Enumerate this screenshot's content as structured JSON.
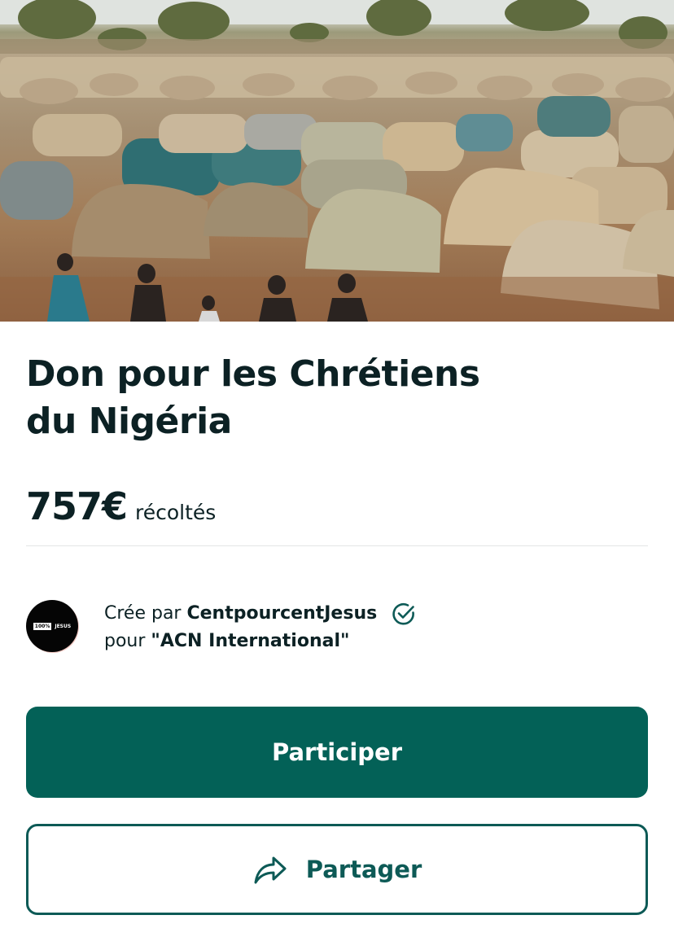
{
  "campaign": {
    "title": "Don pour les Chrétiens du Nigéria",
    "amount": "757€",
    "amount_suffix": "récoltés",
    "image_alt": "Camp de tentes"
  },
  "creator": {
    "created_by_prefix": "Crée par",
    "name": "CentpourcentJesus",
    "verified_icon": "check-circle-icon",
    "for_prefix": "pour",
    "beneficiary": "\"ACN International\"",
    "avatar_text": [
      "100%",
      "JESUS"
    ]
  },
  "actions": {
    "participate_label": "Participer",
    "share_label": "Partager",
    "share_icon": "share-arrow-icon"
  },
  "colors": {
    "primary": "#036157",
    "text": "#0c2124",
    "border": "#0d5a56"
  }
}
